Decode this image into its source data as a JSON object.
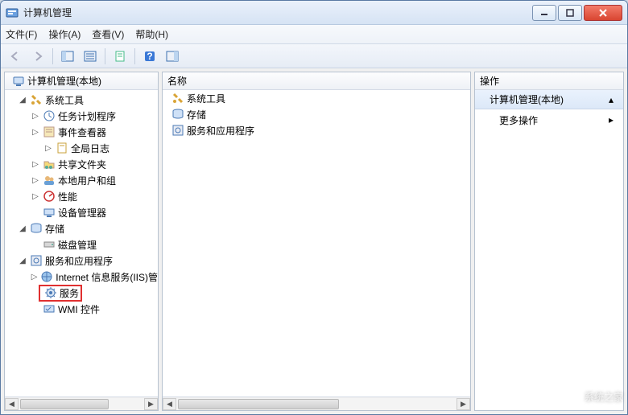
{
  "window": {
    "title": "计算机管理"
  },
  "menu": {
    "file": "文件(F)",
    "action": "操作(A)",
    "view": "查看(V)",
    "help": "帮助(H)"
  },
  "tree": {
    "root": "计算机管理(本地)",
    "system_tools": "系统工具",
    "task_scheduler": "任务计划程序",
    "event_viewer": "事件查看器",
    "global_logs": "全局日志",
    "shared_folders": "共享文件夹",
    "local_users": "本地用户和组",
    "performance": "性能",
    "device_manager": "设备管理器",
    "storage": "存储",
    "disk_management": "磁盘管理",
    "services_apps": "服务和应用程序",
    "iis": "Internet 信息服务(IIS)管",
    "services": "服务",
    "wmi": "WMI 控件"
  },
  "list": {
    "header": "名称",
    "items": [
      {
        "label": "系统工具",
        "icon": "tools"
      },
      {
        "label": "存储",
        "icon": "storage"
      },
      {
        "label": "服务和应用程序",
        "icon": "services"
      }
    ]
  },
  "actions": {
    "header": "操作",
    "section": "计算机管理(本地)",
    "more": "更多操作"
  },
  "watermark": "系统之家"
}
